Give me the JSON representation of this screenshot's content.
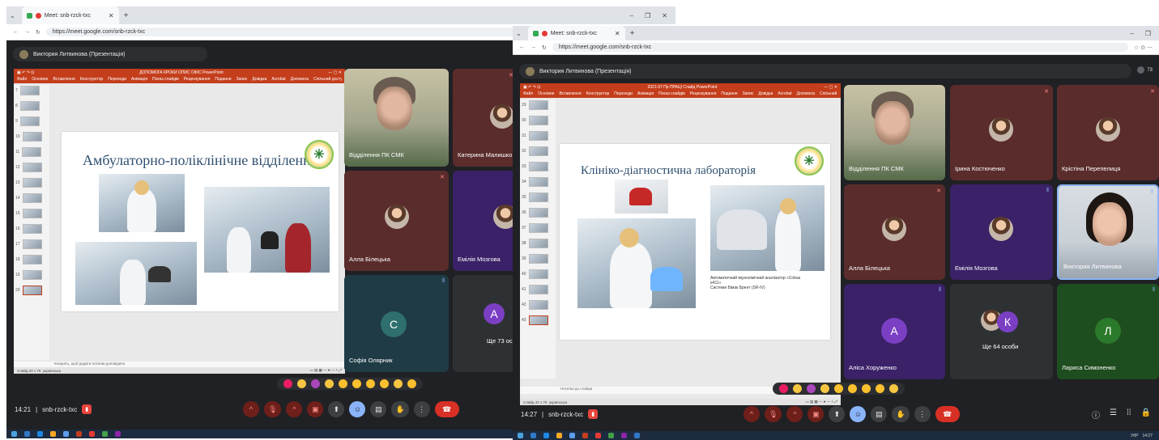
{
  "windowA": {
    "tab_title": "Meet: snb-rzck-txc",
    "url": "https://meet.google.com/snb-rzck-txc",
    "presenter": "Виктория Литвинова (Презентація)",
    "ppt_title": "ДОПОМОГА КРОКИ ОПИС ОФІС PowerPoint",
    "ppt_tabs": [
      "Файл",
      "Основне",
      "Вставлення",
      "Конструктор",
      "Переходи",
      "Анімація",
      "Показ слайдів",
      "Рецензування",
      "Подання",
      "Запис",
      "Довідка",
      "Acrobat",
      "Допомога",
      "Спільний доступ"
    ],
    "slide_numbers": [
      "7",
      "8",
      "9",
      "10",
      "11",
      "12",
      "13",
      "14",
      "15",
      "16",
      "17",
      "18",
      "19",
      "20"
    ],
    "slide_title": "Амбулаторно-поліклінічне відділення",
    "notes": "Клацніть, щоб додати нотатки доповідача",
    "status_left": "Слайд 20 з 76",
    "status_lang": "українська",
    "participants": [
      {
        "name": "Відділення ПК СМК"
      },
      {
        "name": "Катерина Малишко"
      },
      {
        "name": "Алла Білецька"
      },
      {
        "name": "Емілія Мозгова"
      },
      {
        "name": "Софія Олярник",
        "initial": "С"
      },
      {
        "name": "Ще 73 особи",
        "initial": "А"
      }
    ],
    "time": "14:21",
    "meeting_code": "snb-rzck-txc"
  },
  "windowB": {
    "tab_title": "Meet: snb-rzck-txc",
    "url": "https://meet.google.com/snb-rzck-txc",
    "presenter": "Виктория Литвинова (Презентація)",
    "participant_count": "73",
    "ppt_title": "2021-07 Пр ПРАЦІ Слайд PowerPoint",
    "ppt_tabs": [
      "Файл",
      "Основне",
      "Вставлення",
      "Конструктор",
      "Переходи",
      "Анімація",
      "Показ слайдів",
      "Рецензування",
      "Подання",
      "Запис",
      "Довідка",
      "Acrobat",
      "Допомога",
      "Спільний доступ"
    ],
    "slide_numbers": [
      "29",
      "30",
      "31",
      "32",
      "33",
      "34",
      "35",
      "36",
      "37",
      "38",
      "39",
      "40",
      "41",
      "42",
      "43"
    ],
    "slide_title": "Клініко-діагностична лабораторія",
    "caption_lines": [
      "Автоматичний імунохімічний аналізатор «Cobas",
      "e411»",
      "Системи Бімак Брент (SR-IV)"
    ],
    "notes": "Нотатки до слайда",
    "status_left": "Слайд 42 з 76",
    "status_lang": "українська",
    "participants": [
      {
        "name": "Відділення ПК СМК"
      },
      {
        "name": "Ірина Костюченко"
      },
      {
        "name": "Крістіна Перепелиця"
      },
      {
        "name": "Алла Білецька"
      },
      {
        "name": "Емілія Мозгова"
      },
      {
        "name": "Виктория Литвинова"
      },
      {
        "name": "Аліса Хоруженко",
        "initial": "А"
      },
      {
        "name": "Ще 64 особи",
        "initial": "К"
      },
      {
        "name": "Лариса Симоненко",
        "initial": "Л"
      }
    ],
    "time": "14:27",
    "meeting_code": "snb-rzck-txc",
    "tray_lang": "УКР",
    "tray_time": "14:27"
  },
  "colors": {
    "meet_bg": "#202124",
    "ppt_red": "#c43e1c",
    "tile_maroon": "#5b2c2c",
    "tile_teal": "#1f3b45",
    "tile_purple": "#3a2168",
    "tile_green": "#1e4d1f",
    "tile_gray": "#2e3134",
    "avatar_teal": "#2f6f6e",
    "avatar_purple": "#7b3fc4",
    "avatar_green": "#2b7a2b"
  }
}
